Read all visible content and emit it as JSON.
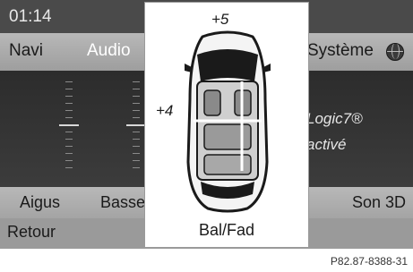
{
  "status": {
    "clock": "01:14"
  },
  "menu": {
    "items": [
      {
        "label": "Navi",
        "active": false
      },
      {
        "label": "Audio",
        "active": true
      },
      {
        "label": "Système",
        "active": false
      }
    ],
    "globe_icon": "globe-icon"
  },
  "logic7": {
    "line1": "Logic7®",
    "line2": "activé"
  },
  "bottom": {
    "items": [
      "Aigus",
      "Basses",
      "Son 3D"
    ]
  },
  "back": {
    "label": "Retour"
  },
  "popup": {
    "fader_value": "+5",
    "balance_value": "+4",
    "label": "Bal/Fad",
    "balance": 4,
    "fader": 5
  },
  "figure_code": "P82.87-8388-31",
  "colors": {
    "screen_bg": "#3a3a3a",
    "menu_bg": "#b0b0b0",
    "popup_bg": "#ffffff",
    "active_text": "#ffffff"
  }
}
